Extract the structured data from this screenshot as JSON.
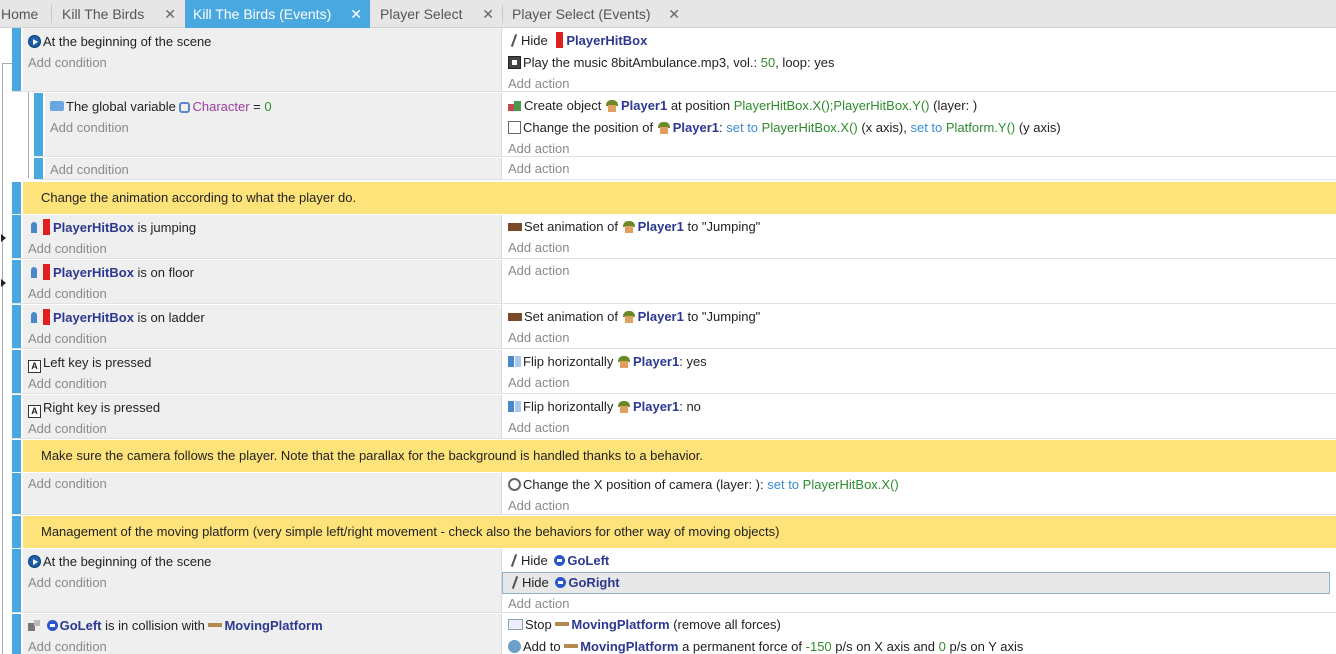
{
  "tabs": [
    {
      "label": "Home",
      "active": false,
      "closable": false
    },
    {
      "label": "Kill The Birds",
      "active": false,
      "closable": true
    },
    {
      "label": "Kill The Birds (Events)",
      "active": true,
      "closable": true
    },
    {
      "label": "Player Select",
      "active": false,
      "closable": true
    },
    {
      "label": "Player Select (Events)",
      "active": false,
      "closable": true
    }
  ],
  "close_glyph": "✕",
  "colors": {
    "accent_blue": "#4aa8e0",
    "comment_yellow": "#fde37a",
    "object_name": "#2b3990",
    "value_green": "#2e8b2e",
    "operator_blue": "#3a8ad6",
    "variable_purple": "#9b3ea0"
  },
  "common": {
    "add_condition": "Add condition",
    "add_action": "Add action"
  },
  "events": {
    "e1": {
      "cond1": "At the beginning of the scene",
      "act1_verb": "Hide",
      "act1_obj": "PlayerHitBox",
      "act2_text": "Play the music 8bitAmbulance.mp3, vol.: ",
      "act2_vol": "50",
      "act2_loop_label": ", loop: yes"
    },
    "e2": {
      "cond_prefix": "The global variable",
      "cond_var": "Character",
      "cond_op": " = ",
      "cond_val": "0",
      "act1_prefix": "Create object",
      "act1_obj": "Player1",
      "act1_at": " at position ",
      "act1_pos": "PlayerHitBox.X();PlayerHitBox.Y()",
      "act1_layer": " (layer: )",
      "act2_prefix": "Change the position of",
      "act2_obj": "Player1",
      "act2_colon": ": ",
      "act2_setto1": "set to",
      "act2_x": "PlayerHitBox.X()",
      "act2_xaxis": " (x axis), ",
      "act2_setto2": "set to",
      "act2_y": "Platform.Y()",
      "act2_yaxis": " (y axis)"
    },
    "comment1": "Change the animation according to what the player do.",
    "e4": {
      "cond_obj": "PlayerHitBox",
      "cond_text": " is jumping",
      "act_prefix": "Set animation of",
      "act_obj": "Player1",
      "act_to": " to ",
      "act_val": "\"Jumping\""
    },
    "e5": {
      "cond_obj": "PlayerHitBox",
      "cond_text": " is on floor"
    },
    "e6": {
      "cond_obj": "PlayerHitBox",
      "cond_text": " is on ladder",
      "act_prefix": "Set animation of",
      "act_obj": "Player1",
      "act_to": " to ",
      "act_val": "\"Jumping\""
    },
    "e7": {
      "key_glyph": "A",
      "cond_text": "Left key is pressed",
      "act_prefix": "Flip horizontally",
      "act_obj": "Player1",
      "act_val": ": yes"
    },
    "e8": {
      "key_glyph": "A",
      "cond_text": "Right key is pressed",
      "act_prefix": "Flip horizontally",
      "act_obj": "Player1",
      "act_val": ": no"
    },
    "comment2": "Make sure the camera follows the player. Note that the parallax for the background is handled thanks to a behavior.",
    "e10": {
      "act_prefix": "Change the X position of camera  (layer: ): ",
      "act_setto": "set to",
      "act_val": "PlayerHitBox.X()"
    },
    "comment3": "Management of the moving platform (very simple left/right movement - check also the behaviors for other way of moving objects)",
    "e12": {
      "cond1": "At the beginning of the scene",
      "act1_verb": "Hide",
      "act1_obj": "GoLeft",
      "act2_verb": "Hide",
      "act2_obj": "GoRight"
    },
    "e13": {
      "cond_obj": "GoLeft",
      "cond_text": " is in collision with ",
      "cond_obj2": "MovingPlatform",
      "act1_verb": "Stop",
      "act1_obj": "MovingPlatform",
      "act1_rest": " (remove all forces)",
      "act2_prefix": "Add to",
      "act2_obj": "MovingPlatform",
      "act2_mid": " a permanent force of ",
      "act2_x": "-150",
      "act2_mid2": " p/s on X axis and ",
      "act2_y": "0",
      "act2_end": " p/s on Y axis"
    }
  }
}
